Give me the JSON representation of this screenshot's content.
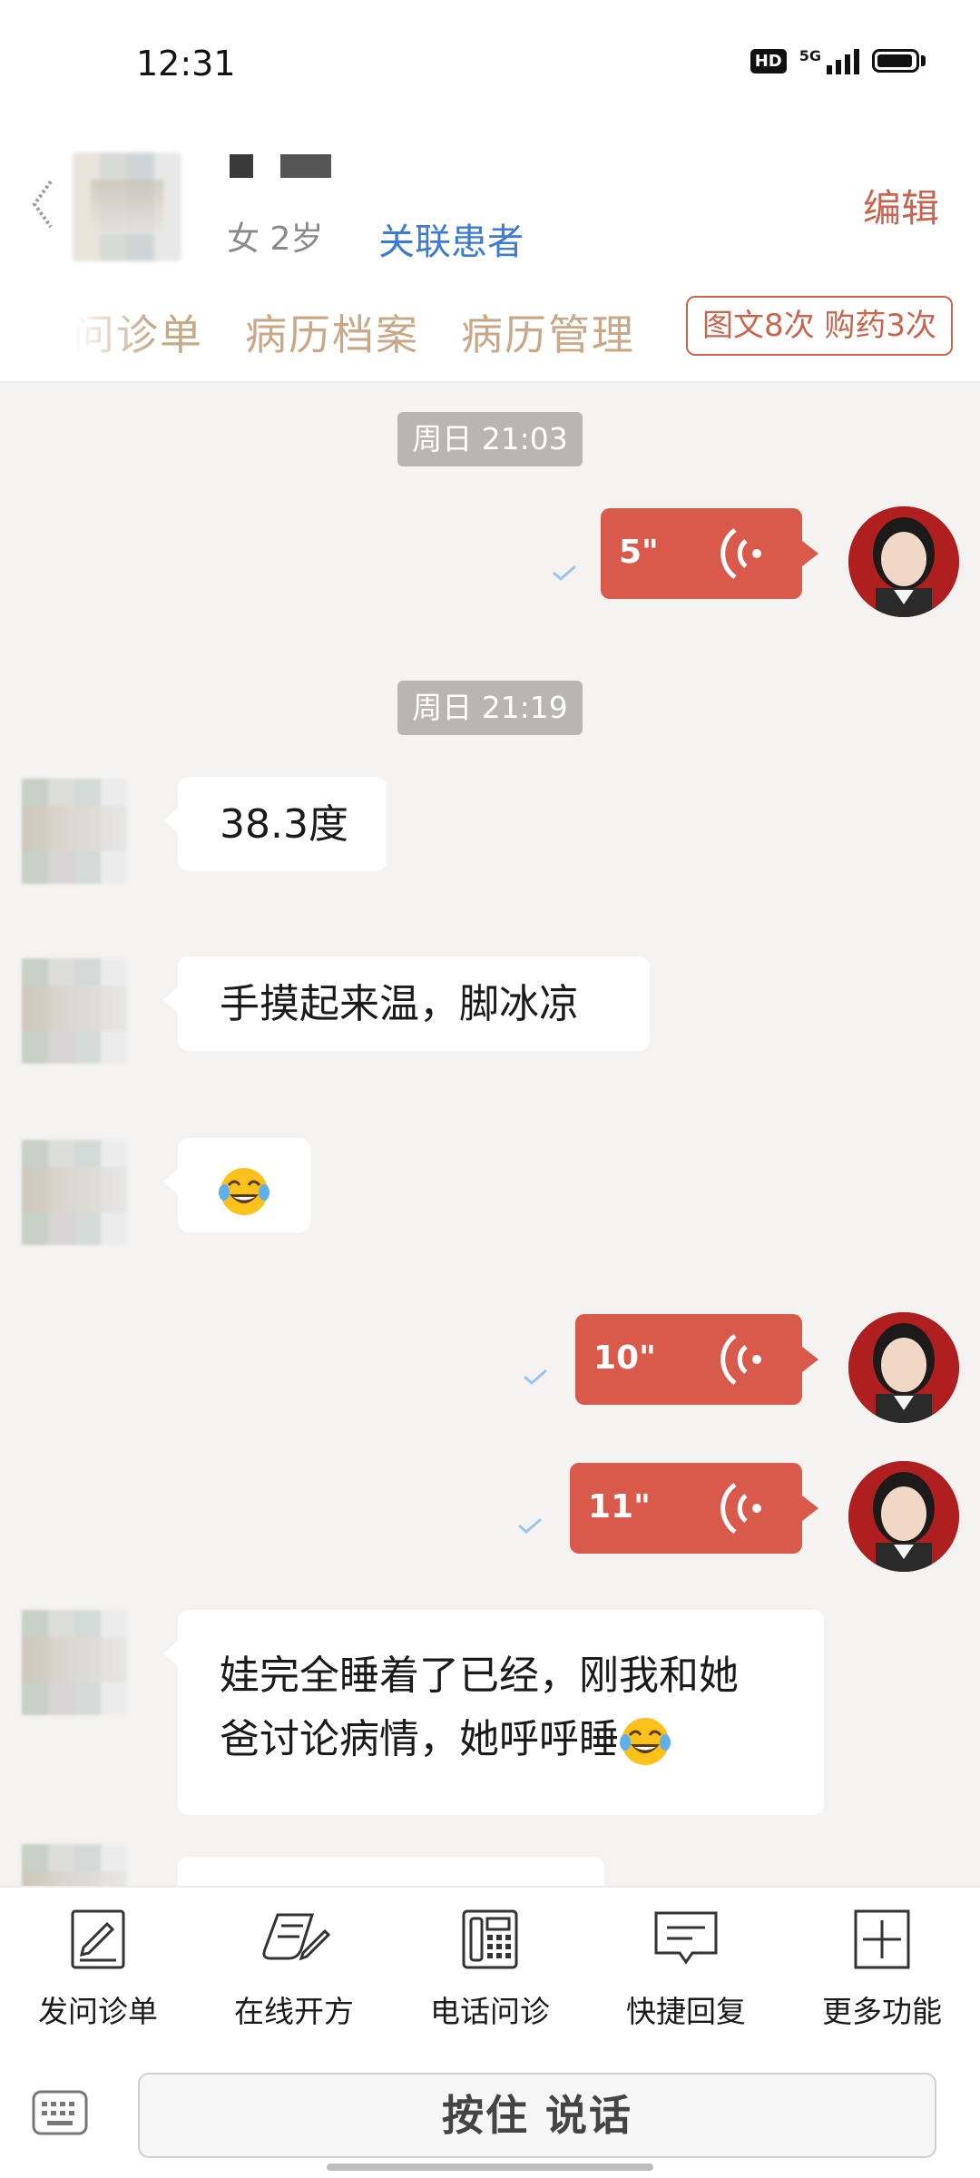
{
  "status_bar": {
    "time": "12:31",
    "hd": "HD",
    "network": "5G"
  },
  "header": {
    "patient_info": "女 2岁",
    "link_patient": "关联患者",
    "edit": "编辑",
    "tabs": [
      "问诊单",
      "病历档案",
      "病历管理"
    ],
    "quota": "图文8次 购药3次"
  },
  "chat": {
    "messages": [
      {
        "type": "time",
        "text": "周日 21:03"
      },
      {
        "type": "voice",
        "from": "doctor",
        "duration": "5\""
      },
      {
        "type": "time",
        "text": "周日 21:19"
      },
      {
        "type": "text",
        "from": "patient",
        "text": "38.3度"
      },
      {
        "type": "text",
        "from": "patient",
        "text": "手摸起来温，脚冰凉"
      },
      {
        "type": "emoji",
        "from": "patient",
        "emoji": "tears-of-joy"
      },
      {
        "type": "voice",
        "from": "doctor",
        "duration": "10\""
      },
      {
        "type": "voice",
        "from": "doctor",
        "duration": "11\""
      },
      {
        "type": "text",
        "from": "patient",
        "lines": [
          "娃完全睡着了已经，刚我和她",
          "爸讨论病情，她呼呼睡"
        ],
        "trailing_emoji": "tears-of-joy"
      }
    ]
  },
  "toolbar": {
    "items": [
      {
        "label": "发问诊单",
        "icon": "form-edit-icon"
      },
      {
        "label": "在线开方",
        "icon": "prescription-icon"
      },
      {
        "label": "电话问诊",
        "icon": "phone-icon"
      },
      {
        "label": "快捷回复",
        "icon": "quick-reply-icon"
      },
      {
        "label": "更多功能",
        "icon": "plus-square-icon"
      }
    ]
  },
  "input_bar": {
    "talk_button": "按住 说话",
    "keyboard_icon": "keyboard-icon"
  },
  "colors": {
    "accent": "#c8654e",
    "voice_bubble": "#d9594a",
    "link": "#3d7bd3",
    "tab_text": "#c9a887",
    "chat_bg": "#f5f3f1"
  }
}
